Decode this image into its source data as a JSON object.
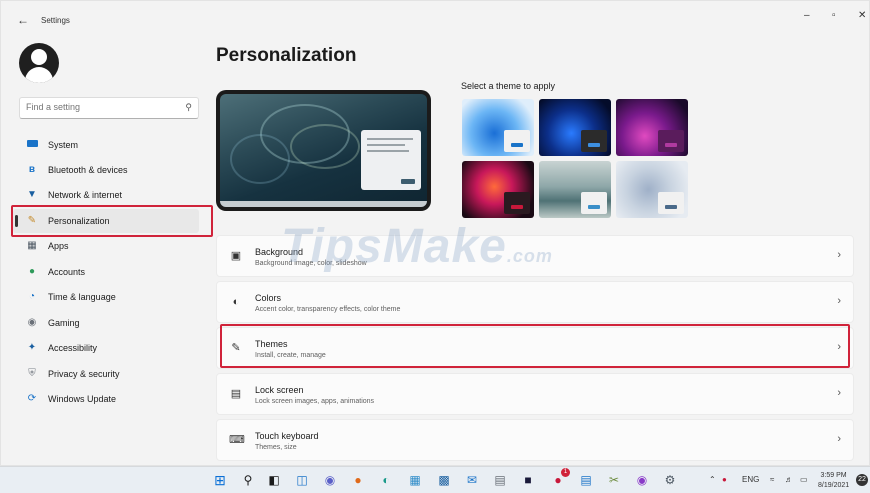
{
  "window": {
    "title": "Settings",
    "back_icon": "←",
    "minimize": "–",
    "maximize": "▫",
    "close": "✕"
  },
  "colors": {
    "highlight": "#d0233a",
    "accent": "#0067c0"
  },
  "sidebar": {
    "search": {
      "placeholder": "Find a setting",
      "value": ""
    },
    "items": [
      {
        "label": "System",
        "icon": "display-icon"
      },
      {
        "label": "Bluetooth & devices",
        "icon": "bluetooth-icon"
      },
      {
        "label": "Network & internet",
        "icon": "wifi-icon"
      },
      {
        "label": "Personalization",
        "icon": "pen-icon",
        "active": true
      },
      {
        "label": "Apps",
        "icon": "apps-icon"
      },
      {
        "label": "Accounts",
        "icon": "person-icon"
      },
      {
        "label": "Time & language",
        "icon": "globe-clock-icon"
      },
      {
        "label": "Gaming",
        "icon": "controller-icon"
      },
      {
        "label": "Accessibility",
        "icon": "accessibility-icon"
      },
      {
        "label": "Privacy & security",
        "icon": "shield-icon"
      },
      {
        "label": "Windows Update",
        "icon": "update-icon"
      }
    ]
  },
  "main": {
    "title": "Personalization",
    "theme_label": "Select a theme to apply",
    "cards": [
      {
        "title": "Background",
        "subtitle": "Background image, color, slideshow",
        "icon": "image-icon"
      },
      {
        "title": "Colors",
        "subtitle": "Accent color, transparency effects, color theme",
        "icon": "palette-icon"
      },
      {
        "title": "Themes",
        "subtitle": "Install, create, manage",
        "icon": "brush-icon",
        "highlighted": true
      },
      {
        "title": "Lock screen",
        "subtitle": "Lock screen images, apps, animations",
        "icon": "lock-screen-icon"
      },
      {
        "title": "Touch keyboard",
        "subtitle": "Themes, size",
        "icon": "keyboard-icon"
      }
    ]
  },
  "watermark": {
    "text": "TipsMake",
    "suffix": ".com"
  },
  "taskbar": {
    "tray": {
      "lang": "ENG",
      "time": "3:59 PM",
      "date": "8/19/2021",
      "notifications": "22",
      "mail_badge": "1"
    }
  }
}
